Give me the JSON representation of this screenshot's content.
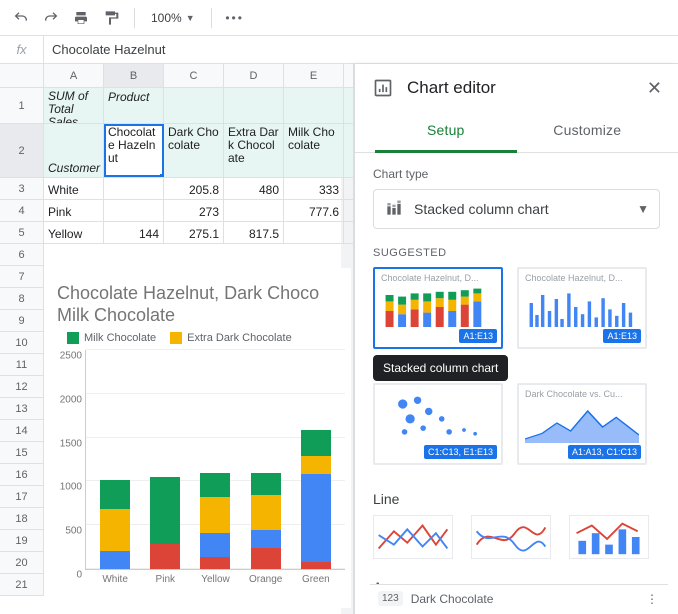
{
  "toolbar": {
    "zoom": "100%"
  },
  "formula": {
    "fx": "fx",
    "value": "Chocolate Hazelnut"
  },
  "columns": [
    "A",
    "B",
    "C",
    "D",
    "E"
  ],
  "row_numbers": [
    1,
    2,
    3,
    4,
    5,
    6,
    7,
    8,
    9,
    10,
    11,
    12,
    13,
    14,
    15,
    16,
    17,
    18,
    19,
    20,
    21
  ],
  "pivot": {
    "sum_label": "SUM of Total Sales",
    "product_label": "Product",
    "customer_label": "Customer",
    "products": [
      "Chocolate Hazelnut",
      "Dark Chocolate",
      "Extra Dark Chocolate",
      "Milk Chocolate"
    ],
    "rows": [
      {
        "customer": "White",
        "vals": [
          "",
          "205.8",
          "480",
          "333"
        ]
      },
      {
        "customer": "Pink",
        "vals": [
          "",
          "273",
          "",
          "777.6"
        ]
      },
      {
        "customer": "Yellow",
        "vals": [
          "144",
          "275.1",
          "817.5",
          ""
        ]
      }
    ]
  },
  "chart_embedded": {
    "title": "Chocolate Hazelnut, Dark Chocolate, Extra Dark Chocolate and Milk Chocolate",
    "title_visible": "Chocolate Hazelnut, Dark Chocolate, Extra Dark Chocolate and Milk Chocolate",
    "legend": [
      {
        "name": "Milk Chocolate",
        "color": "#0f9d58"
      },
      {
        "name": "Extra Dark Chocolate",
        "color": "#f4b400"
      }
    ]
  },
  "chart_data": {
    "type": "bar",
    "stacked": true,
    "categories": [
      "White",
      "Pink",
      "Yellow",
      "Orange",
      "Green"
    ],
    "series": [
      {
        "name": "Chocolate Hazelnut",
        "color": "#db4437",
        "values": [
          0,
          280,
          140,
          240,
          80
        ]
      },
      {
        "name": "Dark Chocolate",
        "color": "#4285f4",
        "values": [
          210,
          0,
          270,
          200,
          1010
        ]
      },
      {
        "name": "Extra Dark Chocolate",
        "color": "#f4b400",
        "values": [
          480,
          0,
          410,
          410,
          200
        ]
      },
      {
        "name": "Milk Chocolate",
        "color": "#0f9d58",
        "values": [
          330,
          770,
          280,
          250,
          300
        ]
      }
    ],
    "ylim": [
      0,
      2500
    ],
    "yticks": [
      0,
      500,
      1000,
      1500,
      2000,
      2500
    ],
    "title": "Chocolate Hazelnut, Dark Chocolate, Extra Dark Chocolate and Milk Chocolate",
    "xlabel": "",
    "ylabel": ""
  },
  "panel": {
    "title": "Chart editor",
    "tabs": {
      "setup": "Setup",
      "customize": "Customize"
    },
    "chart_type_label": "Chart type",
    "chart_type_value": "Stacked column chart",
    "suggested_label": "SUGGESTED",
    "tooltip": "Stacked column chart",
    "thumbs": [
      {
        "title": "Chocolate Hazelnut, D...",
        "range": "A1:E13"
      },
      {
        "title": "Chocolate Hazelnut, D...",
        "range": "A1:E13"
      },
      {
        "title": "",
        "range": "C1:C13, E1:E13"
      },
      {
        "title": "Dark Chocolate vs. Cu...",
        "range": "A1:A13, C1:C13"
      }
    ],
    "line_label": "Line",
    "area_label": "Area"
  },
  "bottom": {
    "icon": "123",
    "text": "Dark Chocolate"
  }
}
